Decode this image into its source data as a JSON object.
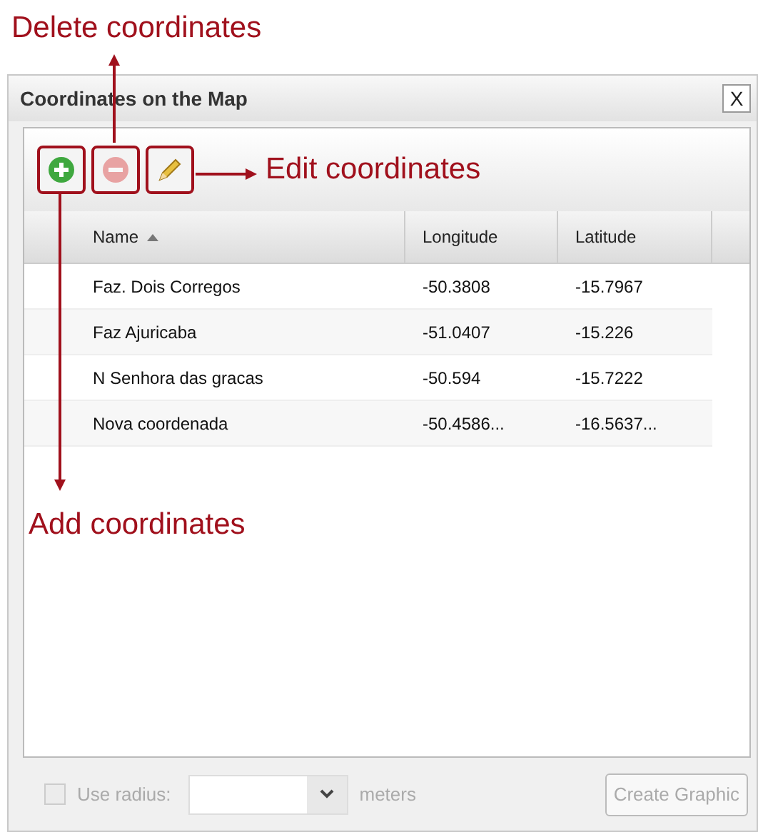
{
  "annotations": {
    "delete": "Delete coordinates",
    "edit": "Edit coordinates",
    "add": "Add coordinates"
  },
  "window": {
    "title": "Coordinates on the Map",
    "close": "X"
  },
  "toolbar": [
    {
      "kind": "add",
      "disabled": false
    },
    {
      "kind": "delete",
      "disabled": true
    },
    {
      "kind": "edit",
      "disabled": false
    }
  ],
  "table": {
    "columns": [
      {
        "label": "Name",
        "sorted": true
      },
      {
        "label": "Longitude",
        "sorted": false
      },
      {
        "label": "Latitude",
        "sorted": false
      }
    ],
    "rows": [
      [
        "Faz. Dois Corregos",
        "-50.3808",
        "-15.7967"
      ],
      [
        "Faz Ajuricaba",
        "-51.0407",
        "-15.226"
      ],
      [
        "N Senhora das gracas",
        "-50.594",
        "-15.7222"
      ],
      [
        "Nova coordenada",
        "-50.4586...",
        "-16.5637..."
      ]
    ]
  },
  "footer": {
    "use_radius": {
      "label": "Use radius:",
      "checked": false,
      "disabled": true
    },
    "radius_unit": "meters",
    "create_button": {
      "label": "Create Graphic",
      "disabled": true
    }
  }
}
